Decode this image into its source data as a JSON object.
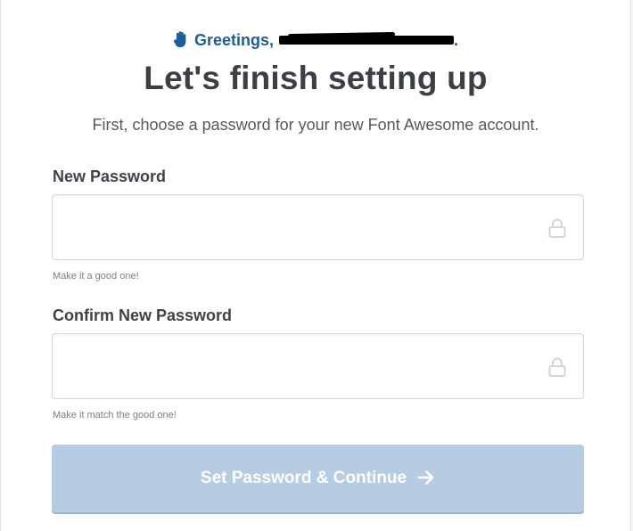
{
  "greeting": {
    "text": "Greetings,",
    "email_redacted": "",
    "trailing": "."
  },
  "title": "Let's finish setting up",
  "subtitle": "First, choose a password for your new Font Awesome account.",
  "fields": [
    {
      "label": "New Password",
      "value": "",
      "placeholder": "",
      "hint": "Make it a good one!",
      "icon": "lock-icon"
    },
    {
      "label": "Confirm New Password",
      "value": "",
      "placeholder": "",
      "hint": "Make it match the good one!",
      "icon": "lock-icon"
    }
  ],
  "submit": {
    "label": "Set Password & Continue",
    "icon": "arrow-right-icon",
    "disabled": true
  },
  "colors": {
    "accent": "#1e5d9c",
    "button_disabled": "#b5cce3",
    "text_dark": "#3c4045"
  }
}
